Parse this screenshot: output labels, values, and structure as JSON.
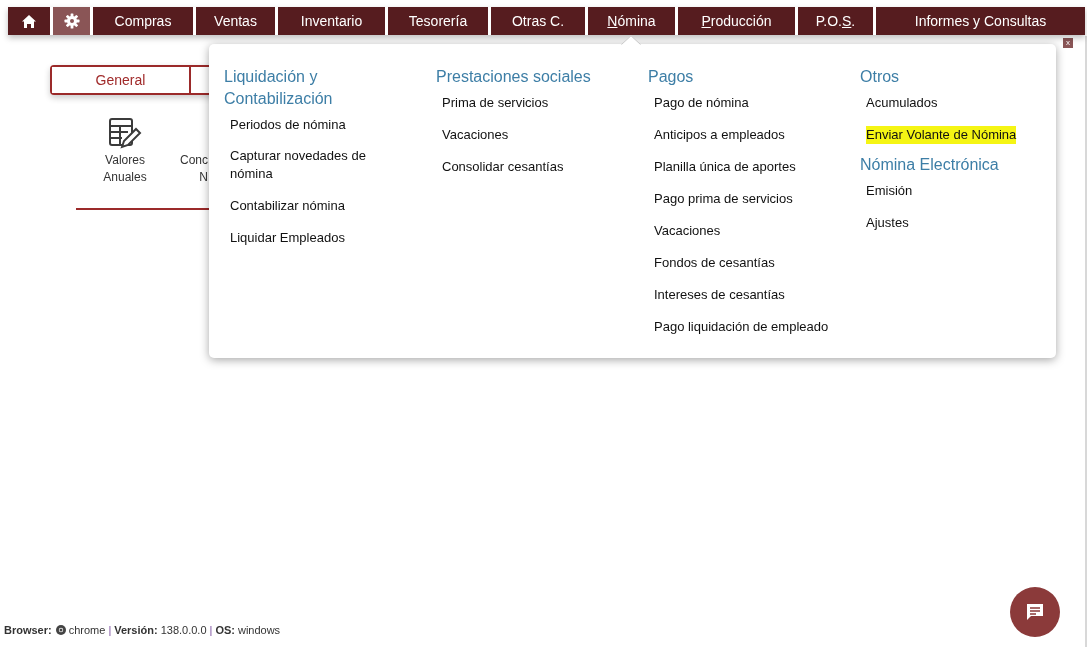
{
  "nav": [
    {
      "kind": "home",
      "selected": false
    },
    {
      "kind": "gear",
      "selected": true
    },
    {
      "kind": "text",
      "label": "Compras",
      "selected": false
    },
    {
      "kind": "text",
      "label": "Ventas",
      "selected": false
    },
    {
      "kind": "text",
      "label": "Inventario",
      "selected": false
    },
    {
      "kind": "text",
      "label": "Tesorería",
      "selected": false
    },
    {
      "kind": "text",
      "label": "Otras C.",
      "selected": false
    },
    {
      "kind": "text",
      "hotkey": "N",
      "label_after": "ómina",
      "selected": false,
      "expanded": true
    },
    {
      "kind": "text",
      "hotkey": "P",
      "label_after": "roducción",
      "selected": false
    },
    {
      "kind": "text",
      "label": "P.O.",
      "hotkey": "S",
      "label_after": ".",
      "selected": false
    },
    {
      "kind": "text",
      "label": "Informes y Consultas",
      "selected": false
    }
  ],
  "tabs": [
    {
      "label": "General",
      "selected": true
    }
  ],
  "shortcuts": [
    {
      "lines": [
        "Valores",
        "Anuales"
      ]
    },
    {
      "lines": [
        "Conc",
        "N"
      ]
    }
  ],
  "dropdown": {
    "columns": [
      {
        "sections": [
          {
            "heading": "Liquidación y Contabilización",
            "items": [
              {
                "label": "Periodos de nómina",
                "highlighted": false
              },
              {
                "label": "Capturar novedades de nómina",
                "highlighted": false
              },
              {
                "label": "Contabilizar nómina",
                "highlighted": false
              },
              {
                "label": "Liquidar Empleados",
                "highlighted": false
              }
            ]
          }
        ]
      },
      {
        "sections": [
          {
            "heading": "Prestaciones sociales",
            "items": [
              {
                "label": "Prima de servicios",
                "highlighted": false
              },
              {
                "label": "Vacaciones",
                "highlighted": false
              },
              {
                "label": "Consolidar cesantías",
                "highlighted": false
              }
            ]
          }
        ]
      },
      {
        "sections": [
          {
            "heading": "Pagos",
            "items": [
              {
                "label": "Pago de nómina",
                "highlighted": false
              },
              {
                "label": "Anticipos a empleados",
                "highlighted": false
              },
              {
                "label": "Planilla única de aportes",
                "highlighted": false
              },
              {
                "label": "Pago prima de servicios",
                "highlighted": false
              },
              {
                "label": "Vacaciones",
                "highlighted": false
              },
              {
                "label": "Fondos de cesantías",
                "highlighted": false
              },
              {
                "label": "Intereses de cesantías",
                "highlighted": false
              },
              {
                "label": "Pago liquidación de empleado",
                "highlighted": false
              }
            ]
          }
        ]
      },
      {
        "sections": [
          {
            "heading": "Otros",
            "items": [
              {
                "label": "Acumulados",
                "highlighted": false
              },
              {
                "label": "Enviar Volante de Nómina",
                "highlighted": true
              }
            ]
          },
          {
            "heading": "Nómina Electrónica",
            "items": [
              {
                "label": "Emisión",
                "highlighted": false
              },
              {
                "label": "Ajustes",
                "highlighted": false
              }
            ]
          }
        ]
      }
    ]
  },
  "close_button": {
    "label": "x"
  },
  "footer": [
    {
      "kind": "key",
      "text": "Browser:"
    },
    {
      "kind": "chrome",
      "text": "chrome"
    },
    {
      "kind": "sep",
      "text": "|"
    },
    {
      "kind": "key",
      "text": "Versión:"
    },
    {
      "kind": "value",
      "text": "138.0.0.0"
    },
    {
      "kind": "sep",
      "text": "|"
    },
    {
      "kind": "key",
      "text": "OS:"
    },
    {
      "kind": "value",
      "text": "windows"
    }
  ]
}
